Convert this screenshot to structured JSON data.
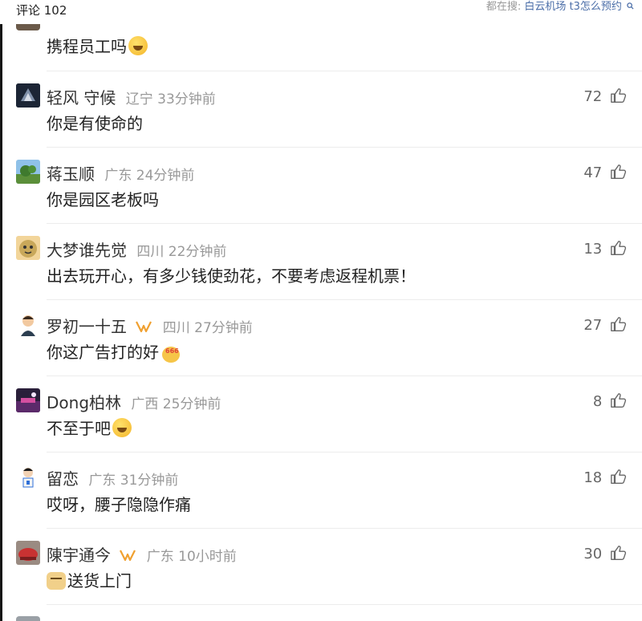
{
  "header": {
    "comment_count": "评论 102",
    "hot_search_label": "都在搜:",
    "hot_search_query": "白云机场 t3怎么预约"
  },
  "partial_comment": {
    "text": "携程员工吗"
  },
  "comments": [
    {
      "name": "轻风 守候",
      "location": "辽宁",
      "time": "33分钟前",
      "text": "你是有使命的",
      "likes": "72"
    },
    {
      "name": "蒋玉顺",
      "location": "广东",
      "time": "24分钟前",
      "text": "你是园区老板吗",
      "likes": "47"
    },
    {
      "name": "大梦谁先觉",
      "location": "四川",
      "time": "22分钟前",
      "text": "出去玩开心，有多少钱使劲花，不要考虑返程机票！",
      "likes": "13"
    },
    {
      "name": "罗初一十五",
      "location": "四川",
      "time": "27分钟前",
      "text": "你这广告打的好",
      "likes": "27"
    },
    {
      "name": "Dong柏林",
      "location": "广西",
      "time": "25分钟前",
      "text": "不至于吧",
      "likes": "8"
    },
    {
      "name": "留恋",
      "location": "广东",
      "time": "31分钟前",
      "text": "哎呀，腰子隐隐作痛",
      "likes": "18"
    },
    {
      "name": "陳宇通今",
      "location": "广东",
      "time": "10小时前",
      "text": "送货上门",
      "likes": "30"
    }
  ],
  "colors": {
    "accent_link": "#4b6ea8",
    "meta_gray": "#999999",
    "badge_orange": "#f0a030"
  },
  "icons": [
    "search-icon",
    "thumbs-up-icon",
    "vip-badge-icon",
    "emoji-laugh-icon",
    "emoji-666-icon",
    "emoji-dog-icon"
  ]
}
